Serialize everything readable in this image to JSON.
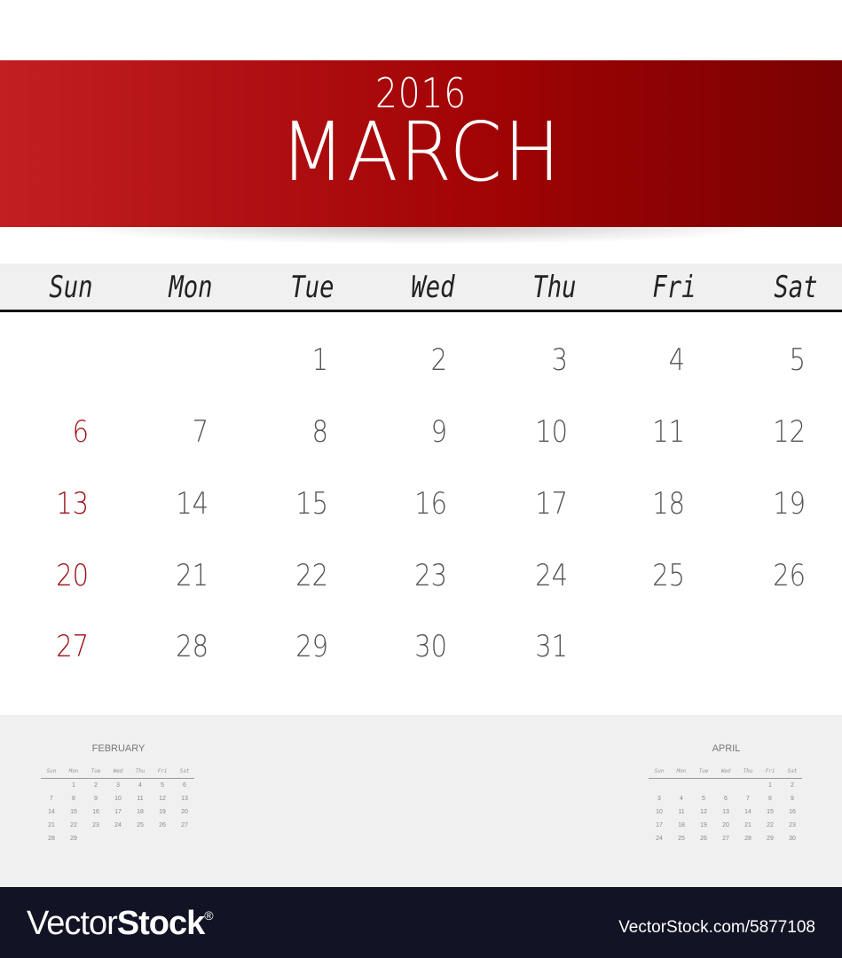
{
  "header": {
    "year": "2016",
    "month": "MARCH",
    "banner_color_start": "#c21f22",
    "banner_color_end": "#7a0202"
  },
  "weekdays": [
    "Sun",
    "Mon",
    "Tue",
    "Wed",
    "Thu",
    "Fri",
    "Sat"
  ],
  "main_calendar": {
    "month": "March",
    "year": 2016,
    "weekend_color": "#9b1116",
    "weeks": [
      [
        "",
        "",
        "1",
        "2",
        "3",
        "4",
        "5"
      ],
      [
        "6",
        "7",
        "8",
        "9",
        "10",
        "11",
        "12"
      ],
      [
        "13",
        "14",
        "15",
        "16",
        "17",
        "18",
        "19"
      ],
      [
        "20",
        "21",
        "22",
        "23",
        "24",
        "25",
        "26"
      ],
      [
        "27",
        "28",
        "29",
        "30",
        "31",
        "",
        ""
      ]
    ]
  },
  "mini_calendars": [
    {
      "title": "FEBRUARY",
      "weekdays": [
        "Sun",
        "Mon",
        "Tue",
        "Wed",
        "Thu",
        "Fri",
        "Sat"
      ],
      "weeks": [
        [
          "",
          "1",
          "2",
          "3",
          "4",
          "5",
          "6"
        ],
        [
          "7",
          "8",
          "9",
          "10",
          "11",
          "12",
          "13"
        ],
        [
          "14",
          "15",
          "16",
          "17",
          "18",
          "19",
          "20"
        ],
        [
          "21",
          "22",
          "23",
          "24",
          "25",
          "26",
          "27"
        ],
        [
          "28",
          "29",
          "",
          "",
          "",
          "",
          ""
        ]
      ]
    },
    {
      "title": "APRIL",
      "weekdays": [
        "Sun",
        "Mon",
        "Tue",
        "Wed",
        "Thu",
        "Fri",
        "Sat"
      ],
      "weeks": [
        [
          "",
          "",
          "",
          "",
          "",
          "1",
          "2"
        ],
        [
          "3",
          "4",
          "5",
          "6",
          "7",
          "8",
          "9"
        ],
        [
          "10",
          "11",
          "12",
          "13",
          "14",
          "15",
          "16"
        ],
        [
          "17",
          "18",
          "19",
          "20",
          "21",
          "22",
          "23"
        ],
        [
          "24",
          "25",
          "26",
          "27",
          "28",
          "29",
          "30"
        ]
      ]
    }
  ],
  "footer": {
    "brand_light": "Vector",
    "brand_bold": "Stock",
    "brand_mark": "®",
    "url": "VectorStock.com/5877108"
  }
}
